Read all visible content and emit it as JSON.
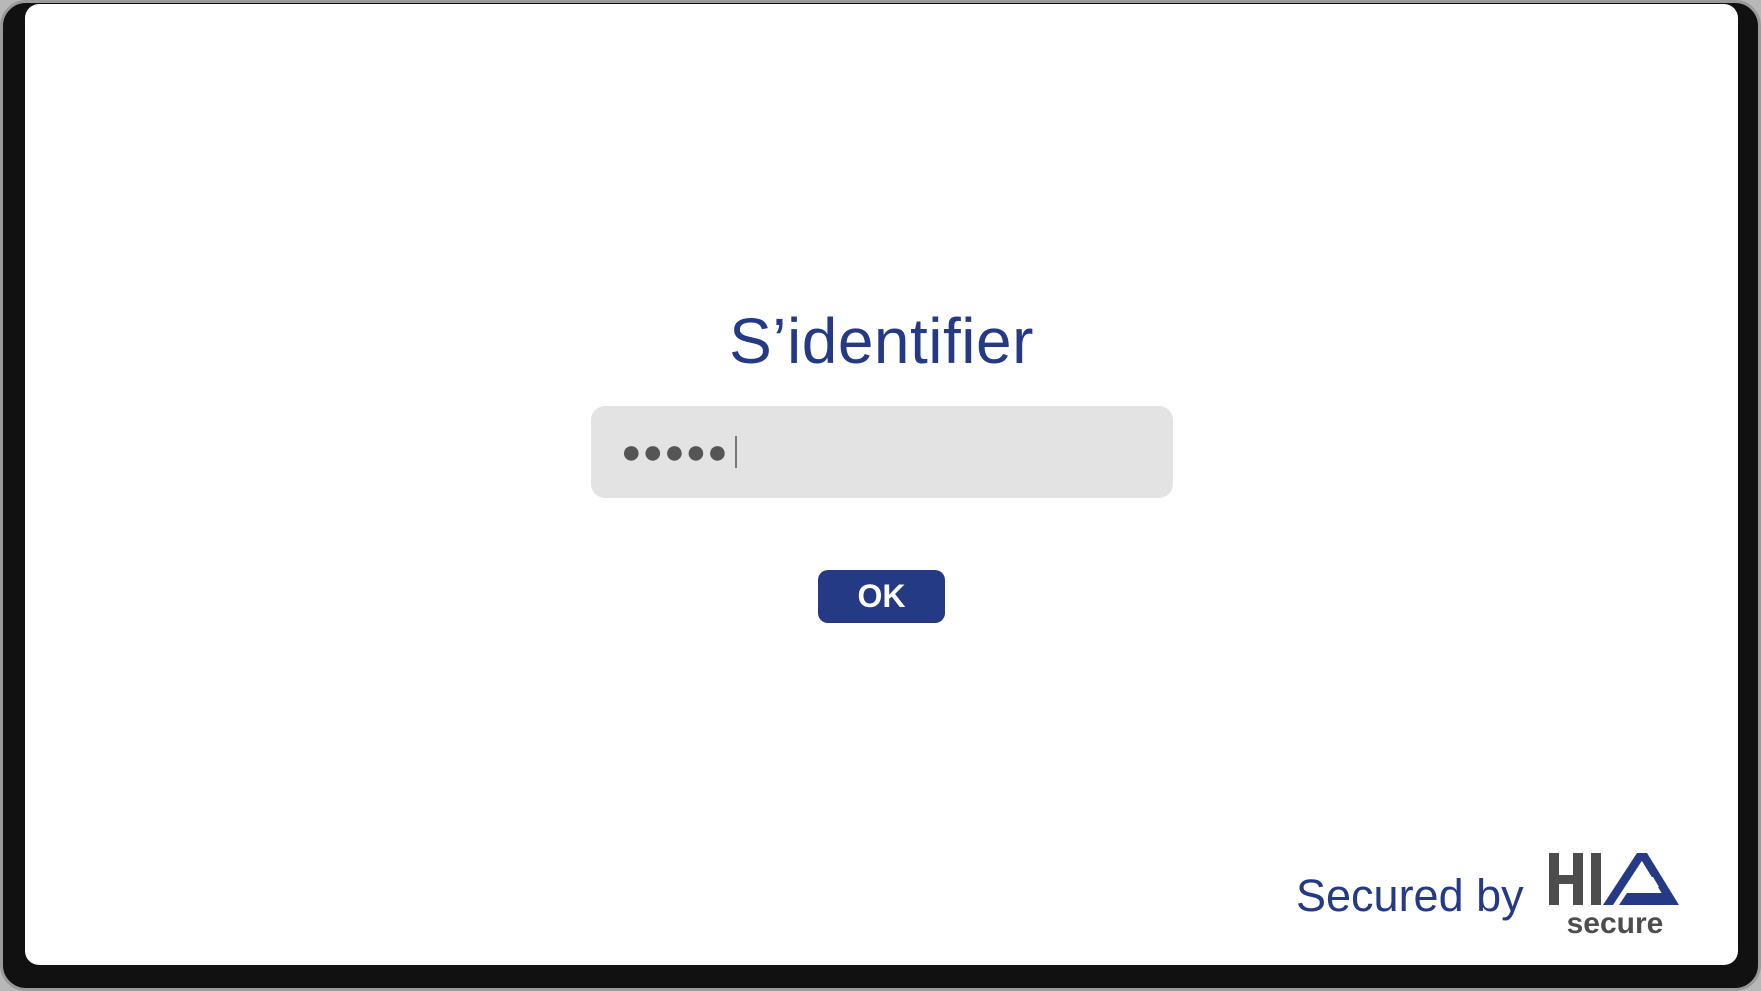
{
  "login": {
    "title": "S’identifier",
    "pin_masked": "●●●●●",
    "ok_label": "OK"
  },
  "footer": {
    "secured_by": "Secured by",
    "logo_text_top": "HIA",
    "logo_text_bottom": "secure"
  },
  "colors": {
    "brand_blue": "#253a84",
    "logo_gray": "#4d4d4d",
    "field_bg": "#e3e3e3"
  }
}
